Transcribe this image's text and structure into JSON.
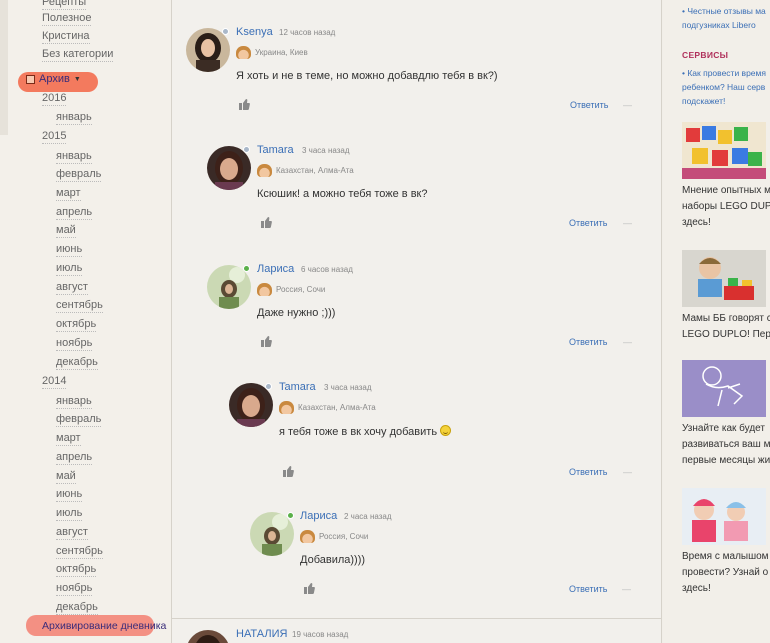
{
  "left_nav": {
    "top_links": [
      "Рецепты",
      "Полезное",
      "Кристина",
      "Без категории"
    ],
    "archive_label": "Архив",
    "archive_diary_label": "Архивирование дневника",
    "years": [
      {
        "year": "2016",
        "months": [
          "январь"
        ]
      },
      {
        "year": "2015",
        "months": [
          "январь",
          "февраль",
          "март",
          "апрель",
          "май",
          "июнь",
          "июль",
          "август",
          "сентябрь",
          "октябрь",
          "ноябрь",
          "декабрь"
        ]
      },
      {
        "year": "2014",
        "months": [
          "январь",
          "февраль",
          "март",
          "апрель",
          "май",
          "июнь",
          "июль",
          "август",
          "сентябрь",
          "октябрь",
          "ноябрь",
          "декабрь"
        ]
      }
    ]
  },
  "comments": [
    {
      "author": "Ksenya",
      "time": "12 часов назад",
      "location": "Украина, Киев",
      "text": "Я хоть и не в теме, но можно добавдлю тебя в вк?)",
      "reply_label": "Ответить",
      "online_color": "#aab8c9"
    },
    {
      "author": "Tamara",
      "time": "3 часа назад",
      "location": "Казахстан, Алма-Ата",
      "text": "Ксюшик! а можно тебя тоже в вк?",
      "reply_label": "Ответить",
      "online_color": "#aab8c9"
    },
    {
      "author": "Лариса",
      "time": "6 часов назад",
      "location": "Россия, Сочи",
      "text": "Даже нужно ;)))",
      "reply_label": "Ответить",
      "online_color": "#5bb04a"
    },
    {
      "author": "Tamara",
      "time": "3 часа назад",
      "location": "Казахстан, Алма-Ата",
      "text": "я тебя тоже в вк хочу добавить",
      "reply_label": "Ответить",
      "online_color": "#aab8c9"
    },
    {
      "author": "Лариса",
      "time": "2 часа назад",
      "location": "Россия, Сочи",
      "text": "Добавила))))",
      "reply_label": "Ответить",
      "online_color": "#5bb04a"
    }
  ],
  "next_comment": {
    "author": "НАТАЛИЯ",
    "time": "19 часов назад"
  },
  "right_sidebar": {
    "top_links": [
      "• Честные отзывы ма",
      "подгузниках Libero"
    ],
    "services_heading": "СЕРВИСЫ",
    "service_links": [
      "• Как провести время",
      "ребенком? Наш серв",
      "подскажет!"
    ],
    "cards": [
      {
        "lines": [
          "Мнение опытных м",
          "наборы LEGO DUPL",
          "здесь!"
        ]
      },
      {
        "lines": [
          "Мамы ББ говорят с",
          "LEGO DUPLO! Пер"
        ]
      },
      {
        "lines": [
          "Узнайте как будет",
          "развиваться ваш м",
          "первые месяцы жи"
        ]
      },
      {
        "lines": [
          "Время с малышом",
          "провести? Узнай о",
          "здесь!"
        ]
      }
    ]
  }
}
